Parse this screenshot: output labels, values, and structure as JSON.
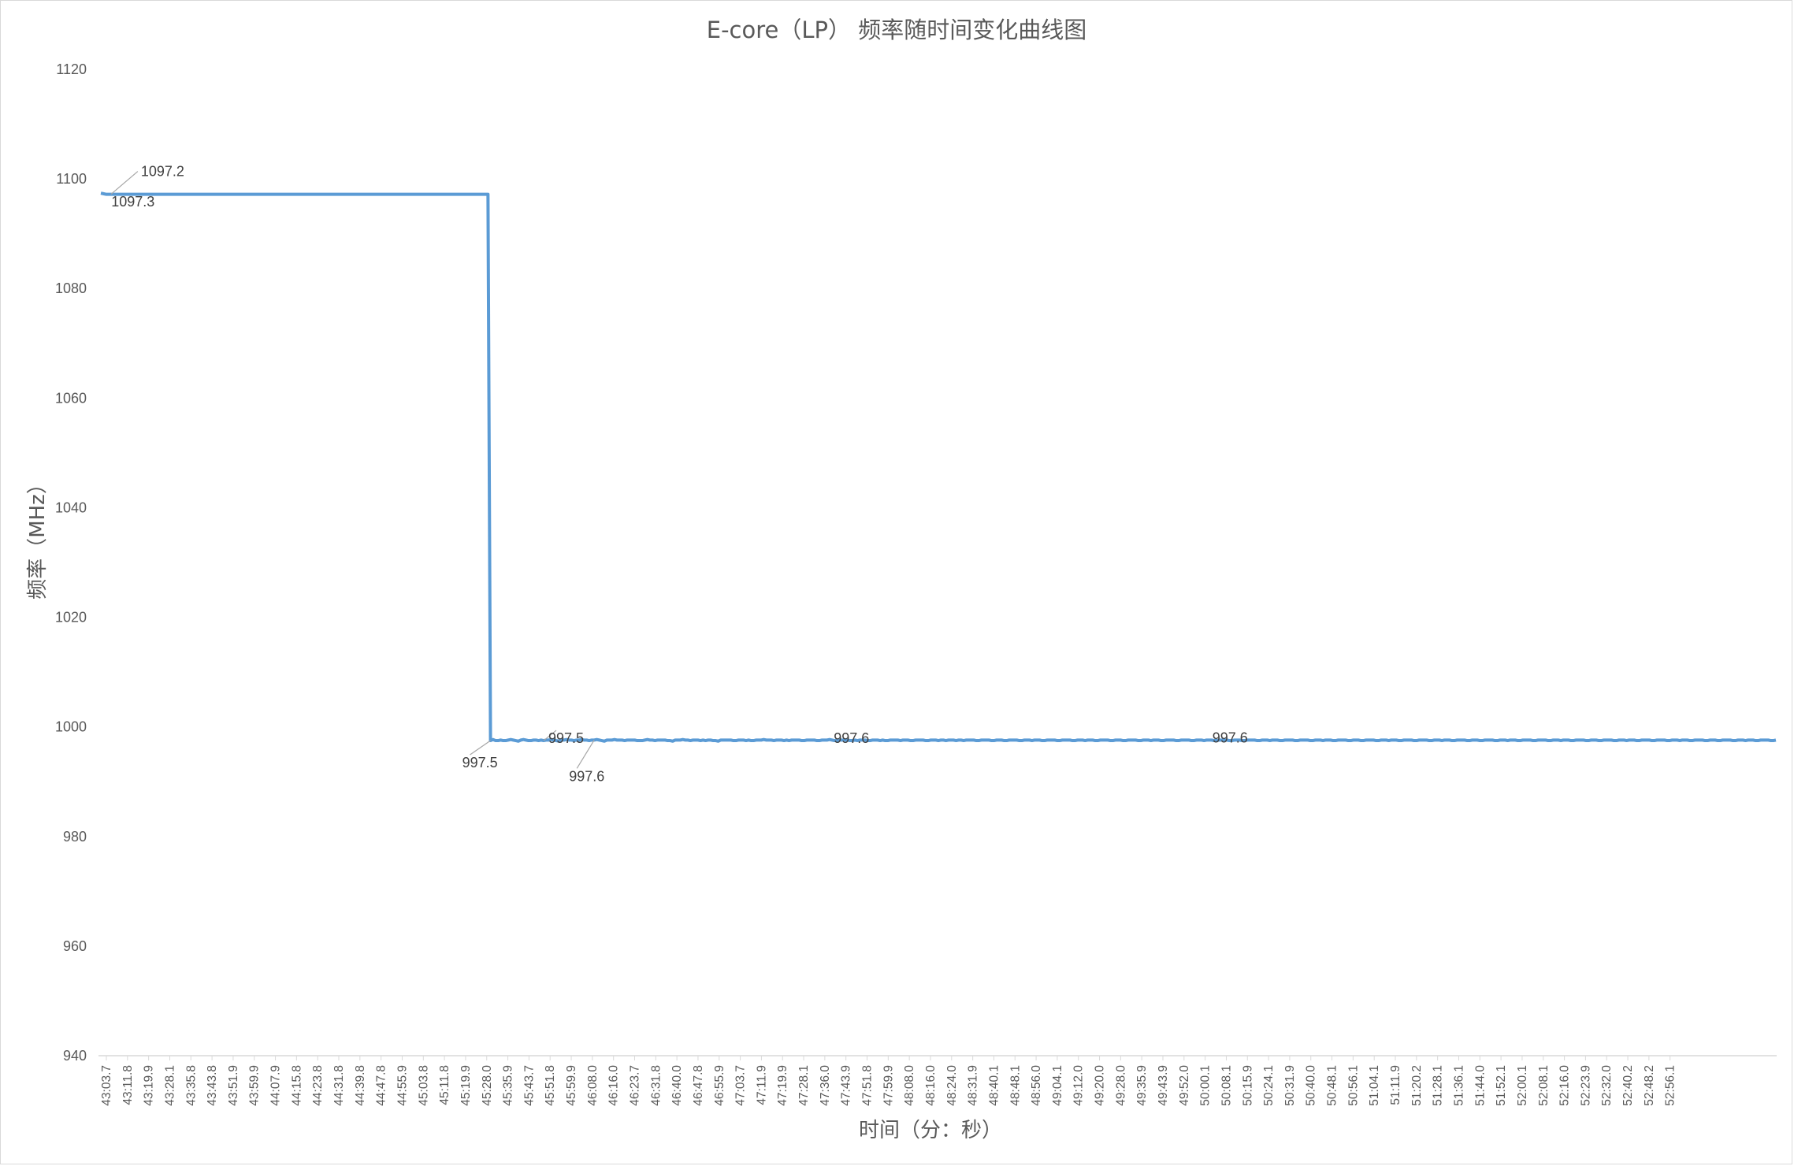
{
  "chart_data": {
    "type": "line",
    "title": "E-core（LP） 频率随时间变化曲线图",
    "xlabel": "时间（分：秒）",
    "ylabel": "频率（MHz）",
    "ylim": [
      940,
      1120
    ],
    "yticks": [
      "1120",
      "1100",
      "1080",
      "1060",
      "1040",
      "1020",
      "1000",
      "980",
      "960",
      "940"
    ],
    "grid": false,
    "legend": "none",
    "line_color": "#5b9bd5",
    "categories": [
      "43:03.7",
      "43:11.8",
      "43:19.9",
      "43:28.1",
      "43:35.8",
      "43:43.8",
      "43:51.9",
      "43:59.9",
      "44:07.9",
      "44:15.8",
      "44:23.8",
      "44:31.8",
      "44:39.8",
      "44:47.8",
      "44:55.9",
      "45:03.8",
      "45:11.8",
      "45:19.9",
      "45:28.0",
      "45:35.9",
      "45:43.7",
      "45:51.8",
      "45:59.9",
      "46:08.0",
      "46:16.0",
      "46:23.7",
      "46:31.8",
      "46:40.0",
      "46:47.8",
      "46:55.9",
      "47:03.7",
      "47:11.9",
      "47:19.9",
      "47:28.1",
      "47:36.0",
      "47:43.9",
      "47:51.8",
      "47:59.9",
      "48:08.0",
      "48:16.0",
      "48:24.0",
      "48:31.9",
      "48:40.1",
      "48:48.1",
      "48:56.0",
      "49:04.1",
      "49:12.0",
      "49:20.0",
      "49:28.0",
      "49:35.9",
      "49:43.9",
      "49:52.0",
      "50:00.1",
      "50:08.1",
      "50:15.9",
      "50:24.1",
      "50:31.9",
      "50:40.0",
      "50:48.1",
      "50:56.1",
      "51:04.1",
      "51:11.9",
      "51:20.2",
      "51:28.1",
      "51:36.1",
      "51:44.0",
      "51:52.1",
      "52:00.1",
      "52:08.1",
      "52:16.0",
      "52:23.9",
      "52:32.0",
      "52:40.2",
      "52:48.2",
      "52:56.1"
    ],
    "series": [
      {
        "values": [
          1097.4,
          1097.3,
          1097.2,
          1097.2,
          1097.2,
          1097.2,
          1097.2,
          1097.2,
          1097.2,
          1097.2,
          1097.2,
          1097.2,
          1097.2,
          1097.2,
          1097.2,
          1097.2,
          1097.2,
          1097.2,
          1097.2,
          1097.2,
          1097.2,
          1097.2,
          1097.2,
          1097.2,
          1097.2,
          1097.2,
          1097.2,
          1097.2,
          1097.2,
          1097.2,
          1097.2,
          1097.2,
          1097.2,
          1097.2,
          1097.2,
          1097.2,
          1097.2,
          1097.2,
          1097.2,
          1097.2,
          1097.2,
          1097.2,
          1097.2,
          1097.2,
          1097.2,
          1097.2,
          1097.2,
          1097.2,
          1097.2,
          1097.2,
          1097.2,
          1097.2,
          1097.2,
          1097.2,
          1097.2,
          1097.2,
          1097.2,
          1097.2,
          1097.2,
          1097.2,
          1097.2,
          1097.2,
          1097.2,
          1097.2,
          1097.2,
          1097.2,
          1097.2,
          1097.2,
          1097.2,
          1097.2,
          1097.2,
          1097.2,
          1097.2,
          1097.2,
          1097.2,
          1097.2,
          1097.2,
          1097.2,
          1097.2,
          1097.2,
          1097.2,
          1097.2,
          1097.2,
          1097.2,
          1097.2,
          1097.2,
          1097.2,
          1097.2,
          1097.2,
          1097.2,
          1097.2,
          1097.2,
          1097.2,
          1097.2,
          1097.2,
          1097.2,
          1097.2,
          1097.2,
          1097.2,
          1097.2,
          1097.2,
          1097.2,
          1097.2,
          1097.2,
          1097.2,
          1097.2,
          1097.2,
          1097.2,
          1097.2,
          1097.2,
          1097.2,
          1097.2,
          1097.2,
          1097.2,
          1097.2,
          1097.2,
          1097.2,
          1097.2,
          1097.2,
          1097.2,
          1097.2,
          1097.2,
          1097.2,
          1097.2,
          1097.2,
          1097.2,
          1097.2,
          1097.2,
          1097.2,
          1097.2,
          1097.2,
          1097.2,
          1097.2,
          1097.2,
          1097.2,
          1097.2,
          1097.2,
          1097.2,
          1097.2,
          1097.2,
          1097.2,
          1097.2,
          1097.2,
          1097.2,
          1097.2,
          1097.2,
          1097.2,
          1097.2,
          1097.2,
          1097.2,
          1097.2,
          1097.2,
          1097.2,
          1097.2,
          997.5,
          997.7,
          997.5,
          997.5,
          997.6,
          997.5,
          997.5,
          997.6,
          997.7,
          997.6,
          997.5,
          997.4,
          997.6,
          997.7,
          997.6,
          997.5,
          997.5,
          997.6,
          997.6,
          997.5,
          997.6,
          997.5,
          997.6,
          997.6,
          997.7,
          997.6,
          997.5,
          997.4,
          997.6,
          997.6,
          997.7,
          997.6,
          997.6,
          997.5,
          997.6,
          997.6,
          997.7,
          997.6,
          997.6,
          997.5,
          997.6,
          997.6,
          997.7,
          997.6,
          997.5,
          997.4,
          997.6,
          997.6,
          997.6,
          997.7,
          997.6,
          997.6,
          997.6,
          997.5,
          997.6,
          997.6,
          997.6,
          997.6,
          997.5,
          997.5,
          997.5,
          997.6,
          997.7,
          997.6,
          997.6,
          997.5,
          997.6,
          997.6,
          997.6,
          997.6,
          997.5,
          997.5,
          997.4,
          997.6,
          997.6,
          997.6,
          997.7,
          997.6,
          997.6,
          997.5,
          997.6,
          997.6,
          997.6,
          997.5,
          997.6,
          997.5,
          997.6,
          997.6,
          997.5,
          997.5,
          997.4,
          997.6,
          997.6,
          997.6,
          997.6,
          997.6,
          997.5,
          997.5,
          997.6,
          997.6,
          997.6,
          997.5,
          997.6,
          997.5,
          997.5,
          997.6,
          997.6,
          997.6,
          997.7,
          997.6,
          997.6,
          997.6,
          997.5,
          997.6,
          997.6,
          997.6,
          997.5,
          997.6,
          997.5,
          997.6,
          997.6,
          997.6,
          997.6,
          997.5,
          997.5,
          997.6,
          997.6,
          997.6,
          997.6,
          997.5,
          997.5,
          997.6,
          997.6,
          997.6,
          997.7,
          997.6,
          997.5,
          997.5,
          997.6,
          997.6,
          997.6,
          997.6,
          997.5,
          997.5,
          997.6,
          997.5,
          997.6,
          997.6,
          997.6,
          997.5,
          997.5,
          997.6,
          997.6,
          997.6,
          997.5,
          997.6,
          997.5,
          997.5,
          997.6,
          997.6,
          997.6,
          997.6,
          997.5,
          997.6,
          997.6,
          997.6,
          997.5,
          997.5,
          997.6,
          997.6,
          997.6,
          997.6,
          997.5,
          997.5,
          997.6,
          997.6,
          997.6,
          997.5,
          997.6,
          997.6,
          997.5,
          997.6,
          997.6,
          997.6,
          997.5,
          997.6,
          997.6,
          997.5,
          997.6,
          997.6,
          997.6,
          997.6,
          997.5,
          997.5,
          997.6,
          997.6,
          997.6,
          997.6,
          997.5,
          997.5,
          997.6,
          997.6,
          997.6,
          997.5,
          997.5,
          997.6,
          997.6,
          997.6,
          997.6,
          997.5,
          997.5,
          997.6,
          997.6,
          997.6,
          997.5,
          997.6,
          997.6,
          997.6,
          997.5,
          997.5,
          997.6,
          997.6,
          997.6,
          997.6,
          997.5,
          997.5,
          997.6,
          997.6,
          997.6,
          997.6,
          997.5,
          997.5,
          997.6,
          997.6,
          997.6,
          997.5,
          997.6,
          997.6,
          997.6,
          997.5,
          997.5,
          997.6,
          997.6,
          997.6,
          997.6,
          997.5,
          997.5,
          997.6,
          997.6,
          997.6,
          997.5,
          997.5,
          997.6,
          997.6,
          997.6,
          997.6,
          997.5,
          997.5,
          997.6,
          997.6,
          997.6,
          997.5,
          997.6,
          997.6,
          997.6,
          997.5,
          997.5,
          997.6,
          997.6,
          997.6,
          997.6,
          997.5,
          997.5,
          997.6,
          997.6,
          997.6,
          997.6,
          997.5,
          997.5,
          997.6,
          997.6,
          997.6,
          997.5,
          997.6,
          997.6,
          997.6,
          997.5,
          997.5,
          997.6,
          997.6,
          997.6,
          997.6,
          997.5,
          997.5,
          997.6,
          997.6,
          997.6,
          997.5,
          997.5,
          997.6,
          997.6,
          997.6,
          997.6,
          997.5,
          997.5,
          997.6,
          997.6,
          997.6,
          997.5,
          997.6,
          997.6,
          997.6,
          997.5,
          997.5,
          997.6,
          997.6,
          997.6,
          997.6,
          997.5,
          997.5,
          997.6,
          997.6,
          997.6,
          997.6,
          997.5,
          997.5,
          997.6,
          997.6,
          997.6,
          997.5,
          997.6,
          997.6,
          997.6,
          997.5,
          997.5,
          997.6,
          997.6,
          997.6,
          997.6,
          997.5,
          997.5,
          997.6,
          997.6,
          997.6,
          997.5,
          997.5,
          997.6,
          997.6,
          997.6,
          997.6,
          997.5,
          997.5,
          997.6,
          997.6,
          997.6,
          997.5,
          997.6,
          997.6,
          997.6,
          997.5,
          997.5,
          997.6,
          997.6,
          997.6,
          997.6,
          997.5,
          997.5,
          997.6,
          997.6,
          997.6,
          997.6,
          997.5,
          997.5,
          997.6,
          997.6,
          997.6,
          997.5,
          997.6,
          997.6,
          997.6,
          997.5,
          997.5,
          997.6,
          997.6,
          997.6,
          997.6,
          997.5,
          997.5,
          997.6,
          997.6,
          997.6,
          997.5,
          997.5,
          997.6,
          997.6,
          997.6,
          997.6,
          997.5,
          997.5,
          997.6,
          997.6,
          997.6,
          997.5,
          997.6,
          997.6,
          997.6,
          997.5,
          997.5,
          997.6,
          997.6,
          997.6,
          997.6,
          997.5,
          997.5,
          997.6,
          997.6,
          997.6,
          997.6,
          997.5,
          997.5,
          997.6,
          997.6,
          997.6,
          997.5,
          997.6,
          997.6,
          997.6,
          997.5,
          997.5,
          997.6,
          997.6,
          997.6,
          997.6,
          997.5,
          997.5,
          997.6,
          997.6,
          997.6,
          997.5,
          997.5,
          997.6,
          997.6,
          997.6,
          997.6,
          997.5,
          997.5,
          997.6,
          997.6,
          997.6,
          997.5,
          997.6,
          997.6,
          997.6,
          997.5,
          997.5,
          997.6,
          997.6,
          997.6,
          997.6,
          997.5,
          997.5,
          997.6,
          997.6,
          997.6,
          997.6,
          997.5,
          997.5,
          997.6,
          997.6,
          997.6,
          997.5,
          997.6,
          997.6,
          997.6,
          997.5,
          997.5,
          997.6,
          997.6,
          997.6,
          997.6,
          997.5,
          997.5,
          997.6,
          997.6,
          997.6,
          997.5,
          997.5,
          997.6,
          997.6,
          997.6,
          997.6,
          997.5,
          997.5,
          997.6,
          997.6,
          997.6,
          997.5,
          997.6,
          997.6,
          997.6,
          997.5,
          997.5,
          997.6,
          997.6,
          997.6,
          997.6,
          997.5,
          997.5,
          997.6
        ]
      }
    ],
    "data_labels": [
      {
        "index": 1,
        "text": "1097.3"
      },
      {
        "index": 4,
        "text": "1097.2"
      },
      {
        "index": 154,
        "text": "997.5"
      },
      {
        "index": 175,
        "text": "997.5"
      },
      {
        "index": 195,
        "text": "997.6"
      },
      {
        "index": 195,
        "text": "997.6"
      },
      {
        "index": 299,
        "text": "997.6"
      },
      {
        "index": 448,
        "text": "997.6"
      }
    ]
  }
}
